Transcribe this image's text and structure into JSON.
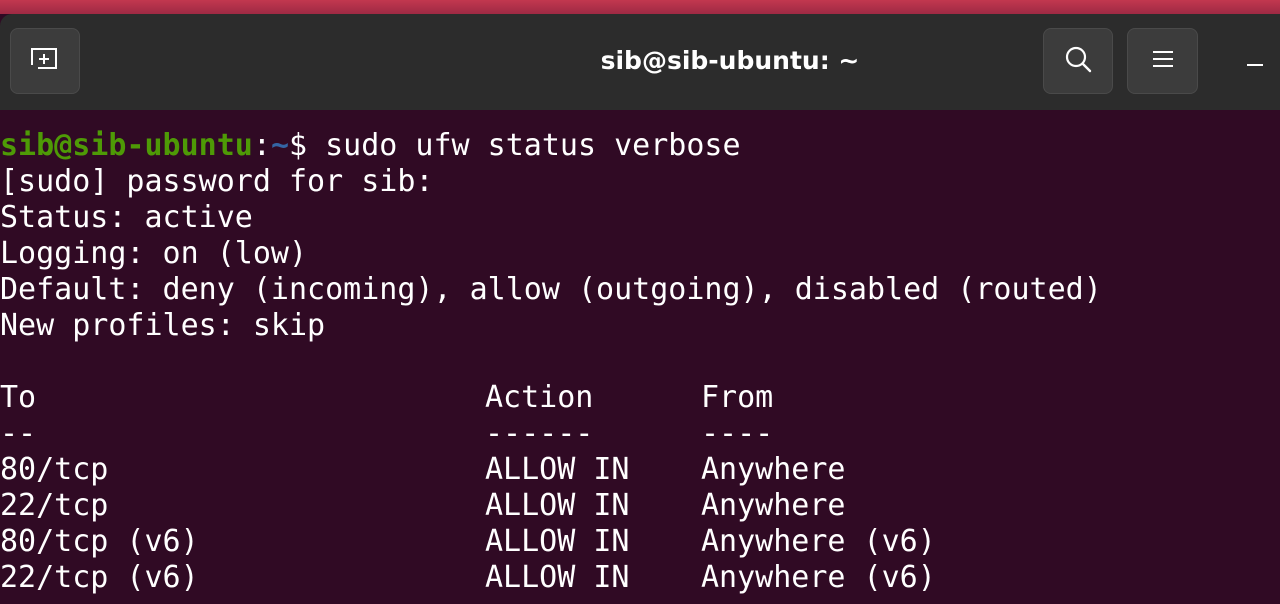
{
  "window": {
    "title": "sib@sib-ubuntu: ~"
  },
  "icons": {
    "new_tab": "new-tab-icon",
    "search": "search-icon",
    "menu": "hamburger-menu-icon",
    "minimize": "minimize-icon"
  },
  "colors": {
    "terminal_bg": "#300a24",
    "titlebar_bg": "#2c2c2c",
    "prompt_user": "#4e9a06",
    "prompt_path": "#3465a4",
    "text": "#ffffff"
  },
  "terminal": {
    "prompt": {
      "user_host": "sib@sib-ubuntu",
      "separator": ":",
      "path": "~",
      "symbol": "$",
      "command": " sudo ufw status verbose"
    },
    "output": [
      "[sudo] password for sib:",
      "Status: active",
      "Logging: on (low)",
      "Default: deny (incoming), allow (outgoing), disabled (routed)",
      "New profiles: skip"
    ],
    "table": {
      "headers": [
        "To",
        "Action",
        "From"
      ],
      "separators": [
        "--",
        "------",
        "----"
      ],
      "rows": [
        [
          "80/tcp",
          "ALLOW IN",
          "Anywhere"
        ],
        [
          "22/tcp",
          "ALLOW IN",
          "Anywhere"
        ],
        [
          "80/tcp (v6)",
          "ALLOW IN",
          "Anywhere (v6)"
        ],
        [
          "22/tcp (v6)",
          "ALLOW IN",
          "Anywhere (v6)"
        ]
      ]
    }
  }
}
